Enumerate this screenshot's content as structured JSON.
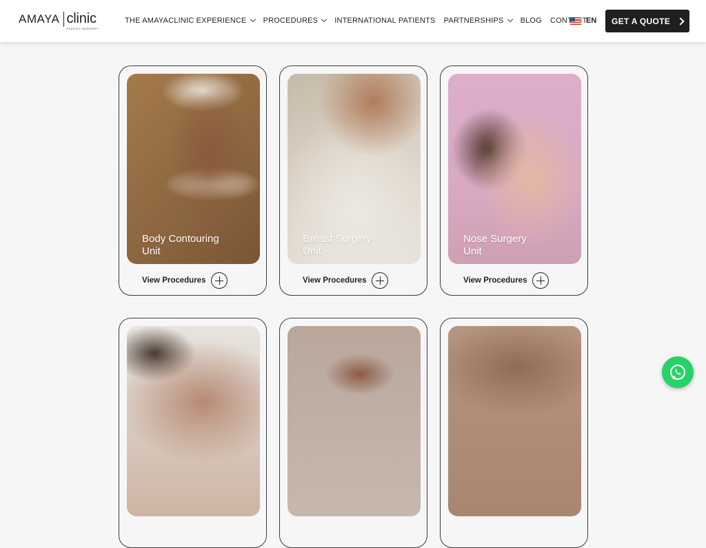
{
  "brand": {
    "name_left": "AMAYA",
    "name_right": "clinic",
    "tagline": "PLASTIC SURGERY"
  },
  "nav": {
    "items": [
      {
        "label": "THE AMAYACLINIC EXPERIENCE",
        "has_dropdown": true
      },
      {
        "label": "PROCEDURES",
        "has_dropdown": true
      },
      {
        "label": "INTERNATIONAL PATIENTS",
        "has_dropdown": false
      },
      {
        "label": "PARTNERSHIPS",
        "has_dropdown": true
      },
      {
        "label": "BLOG",
        "has_dropdown": false
      },
      {
        "label": "CONTACT",
        "has_dropdown": false
      }
    ],
    "language": "EN",
    "cta": "GET A QUOTE"
  },
  "cards": [
    {
      "title_line1": "Body Contouring",
      "title_line2": "Unit",
      "link": "View Procedures",
      "image": "body-contouring-photo"
    },
    {
      "title_line1": "Breast Surgery",
      "title_line2": "Unit",
      "link": "View Procedures",
      "image": "breast-surgery-photo"
    },
    {
      "title_line1": "Nose Surgery",
      "title_line2": "Unit",
      "link": "View Procedures",
      "image": "nose-surgery-photo"
    },
    {
      "image": "face-surgery-photo"
    },
    {
      "image": "twin-profile-photo"
    },
    {
      "image": "breast-bra-photo"
    }
  ],
  "icons": {
    "chevron": "chevron-down-icon",
    "flag": "us-flag-icon",
    "plus": "plus-circle-icon",
    "whatsapp": "whatsapp-icon"
  },
  "colors": {
    "header_bg": "#ffffff",
    "page_bg": "#f6f6f6",
    "cta_bg": "#1f1f1f",
    "whatsapp": "#25d366"
  }
}
